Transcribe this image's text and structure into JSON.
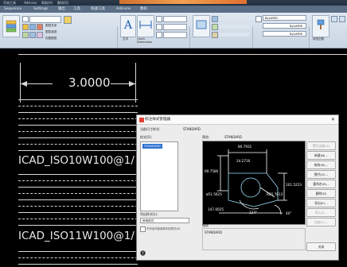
{
  "app": {
    "title_bar": [
      "开始工具",
      "Add-ons",
      "帮助(H)",
      "数码(D)"
    ],
    "tabs": [
      "Sequence",
      "Settings",
      "输出",
      "工具",
      "快速工具",
      "Add-ons",
      "数码"
    ]
  },
  "ribbon": {
    "style_text": "文字",
    "layer_off": "图层关闭",
    "layer_walk": "图层漫游",
    "match_layer": "匹配图层",
    "quick_select": "Quick\nDimension",
    "properties_label": "特性匹配",
    "layer_field": "ByLAYER",
    "linetype_field": "ByLAYER",
    "lineweight_field": "ByLAYER",
    "group_layers": "图层",
    "group_annotation": "注释",
    "group_block": "块",
    "group_properties": "特性",
    "group_modify": "修改"
  },
  "drawing": {
    "dimension_value": "3.0000",
    "label_1": "ICAD_ISO10W100@1/",
    "label_2": "ICAD_ISO11W100@1/"
  },
  "dialog": {
    "title": "标注样式管理器",
    "close": "✕",
    "current_style_label": "当前尺寸样式:",
    "current_style_value": "STANDARD",
    "styles_label": "样式(S):",
    "preview_label": "预览:",
    "preview_value": "STANDARD",
    "selected_style": "STANDARD",
    "list_label": "列出样式(L):",
    "list_value": "所有样式",
    "list_checkbox": "不列出外部参照中的样式(D)",
    "description_label": "描述",
    "description_value": "STANDARD",
    "buttons": [
      "置为当前(U)",
      "新建(N)...",
      "修改(M)...",
      "替代(O)...",
      "重命名(R)...",
      "删除(D)",
      "导出(E)...",
      "导入(I)...",
      "比较(C)...",
      "关闭"
    ],
    "disabled_buttons": [
      0,
      7,
      8
    ]
  },
  "preview_dims": {
    "d1": "80.7931",
    "d2": "69.7580",
    "d3": "24.2716",
    "d4": "101.5253",
    "d5": "ø51.5625",
    "d6": "R25.7813",
    "d7": "147.0025",
    "d8": "124°",
    "d9": "40°"
  }
}
